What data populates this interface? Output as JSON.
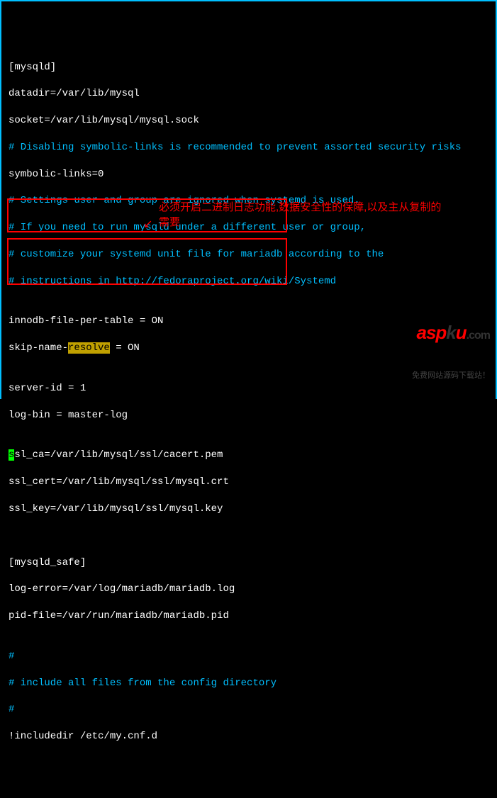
{
  "lines": {
    "l1": "[mysqld]",
    "l2": "datadir=/var/lib/mysql",
    "l3": "socket=/var/lib/mysql/mysql.sock",
    "l4": "# Disabling symbolic-links is recommended to prevent assorted security risks",
    "l5": "symbolic-links=0",
    "l6": "# Settings user and group are ignored when systemd is used.",
    "l7": "# If you need to run mysqld under a different user or group,",
    "l8": "# customize your systemd unit file for mariadb according to the",
    "l9": "# instructions in http://fedoraproject.org/wiki/Systemd",
    "l10": "",
    "l11a": "innodb-file-per-table = ON",
    "l12_pre": "skip-name-",
    "l12_hl": "resolve",
    "l12_post": " = ON",
    "l13": "",
    "l14": "server-id = 1",
    "l15": "log-bin = master-log",
    "l16": "",
    "l17_cursor": "s",
    "l17_rest": "sl_ca=/var/lib/mysql/ssl/cacert.pem",
    "l18": "ssl_cert=/var/lib/mysql/ssl/mysql.crt",
    "l19": "ssl_key=/var/lib/mysql/ssl/mysql.key",
    "l20": "",
    "l21": "",
    "l22": "[mysqld_safe]",
    "l23": "log-error=/var/log/mariadb/mariadb.log",
    "l24": "pid-file=/var/run/mariadb/mariadb.pid",
    "l25": "",
    "l26": "#",
    "l27": "# include all files from the config directory",
    "l28": "#",
    "l29": "!includedir /etc/my.cnf.d"
  },
  "annotation": {
    "text": "必须开启二进制日志功能,数据安全性的保障,以及主从复制的需要",
    "arrow": "↙"
  },
  "watermark": {
    "logo_asp": "asp",
    "logo_k": "k",
    "logo_u": "u",
    "logo_com": ".com",
    "subtitle": "免费网站源码下载站！"
  }
}
